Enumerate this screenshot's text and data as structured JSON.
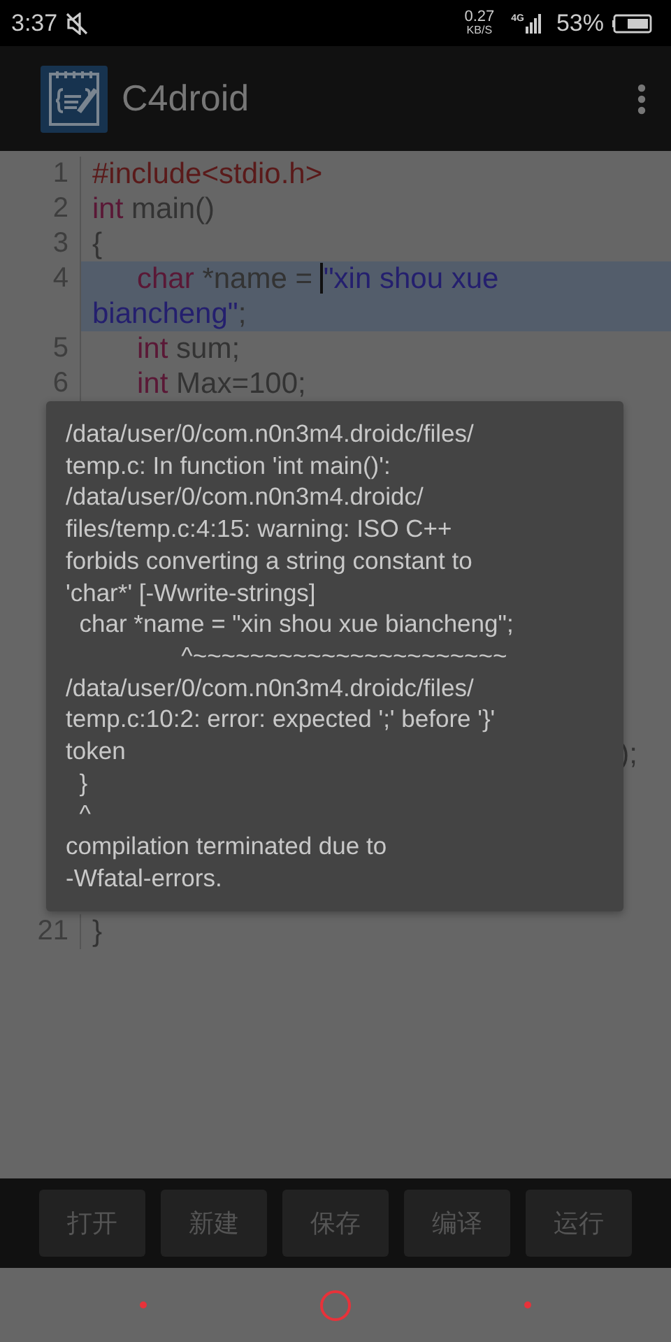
{
  "status_bar": {
    "time": "3:37",
    "speed_value": "0.27",
    "speed_unit": "KB/S",
    "network": "4G",
    "battery": "53%"
  },
  "app_bar": {
    "title": "C4droid"
  },
  "editor": {
    "lines": [
      {
        "number": "1",
        "selected": false,
        "indented": false,
        "segments": [
          {
            "kind": "directive",
            "text": "#include<stdio.h>"
          }
        ]
      },
      {
        "number": "2",
        "selected": false,
        "indented": false,
        "segments": [
          {
            "kind": "keyword",
            "text": "int"
          },
          {
            "kind": "plain",
            "text": " main()"
          }
        ]
      },
      {
        "number": "3",
        "selected": false,
        "indented": false,
        "segments": [
          {
            "kind": "plain",
            "text": "{"
          }
        ]
      },
      {
        "number": "4",
        "selected": true,
        "indented": true,
        "segments": [
          {
            "kind": "keyword",
            "text": "char"
          },
          {
            "kind": "plain",
            "text": " *name = "
          },
          {
            "kind": "cursor"
          },
          {
            "kind": "string",
            "text": "\"xin shou xue biancheng\""
          },
          {
            "kind": "plain",
            "text": ";"
          }
        ]
      },
      {
        "number": "5",
        "selected": false,
        "indented": true,
        "segments": [
          {
            "kind": "keyword",
            "text": "int"
          },
          {
            "kind": "plain",
            "text": " sum;"
          }
        ]
      },
      {
        "number": "6",
        "selected": false,
        "indented": true,
        "segments": [
          {
            "kind": "keyword",
            "text": "int"
          },
          {
            "kind": "plain",
            "text": " Max=100;"
          }
        ]
      }
    ],
    "hidden_fragment": ");",
    "last_line": {
      "number": "21",
      "selected": false,
      "indented": false,
      "segments": [
        {
          "kind": "plain",
          "text": "}"
        }
      ]
    }
  },
  "dialog": {
    "message": "/data/user/0/com.n0n3m4.droidc/files/\ntemp.c: In function 'int main()':\n/data/user/0/com.n0n3m4.droidc/\nfiles/temp.c:4:15: warning: ISO C++\nforbids converting a string constant to\n'char*' [-Wwrite-strings]\n  char *name = \"xin shou xue biancheng\";\n                 ^~~~~~~~~~~~~~~~~~~~~~~\n/data/user/0/com.n0n3m4.droidc/files/\ntemp.c:10:2: error: expected ';' before '}'\ntoken\n  }\n  ^\ncompilation terminated due to\n-Wfatal-errors."
  },
  "toolbar": {
    "buttons": [
      "打开",
      "新建",
      "保存",
      "编译",
      "运行"
    ]
  }
}
